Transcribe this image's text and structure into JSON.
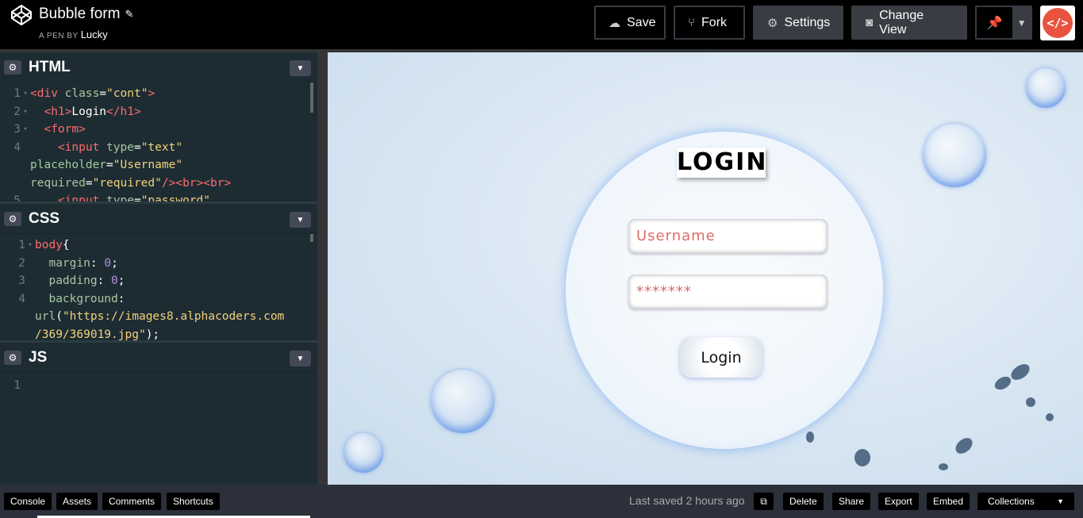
{
  "header": {
    "title": "Bubble form",
    "byline_prefix": "A PEN BY",
    "author": "Lucky",
    "buttons": {
      "save": "Save",
      "fork": "Fork",
      "settings": "Settings",
      "change_view": "Change View"
    }
  },
  "editors": {
    "html": {
      "label": "HTML",
      "lines": [
        {
          "n": "1",
          "parts": [
            [
              "tag",
              "<div "
            ],
            [
              "attr",
              "class"
            ],
            [
              "plain",
              "="
            ],
            [
              "str",
              "\"cont\""
            ],
            [
              "tag",
              ">"
            ]
          ]
        },
        {
          "n": "2",
          "parts": [
            [
              "plain",
              "  "
            ],
            [
              "tag",
              "<h1>"
            ],
            [
              "plain",
              "Login"
            ],
            [
              "tag",
              "</h1>"
            ]
          ]
        },
        {
          "n": "3",
          "parts": [
            [
              "plain",
              "  "
            ],
            [
              "tag",
              "<form>"
            ]
          ]
        },
        {
          "n": "4",
          "parts": [
            [
              "plain",
              "    "
            ],
            [
              "tag",
              "<input "
            ],
            [
              "attr",
              "type"
            ],
            [
              "plain",
              "="
            ],
            [
              "str",
              "\"text\""
            ]
          ]
        },
        {
          "n": "",
          "parts": [
            [
              "attr",
              "placeholder"
            ],
            [
              "plain",
              "="
            ],
            [
              "str",
              "\"Username\""
            ]
          ]
        },
        {
          "n": "",
          "parts": [
            [
              "attr",
              "required"
            ],
            [
              "plain",
              "="
            ],
            [
              "str",
              "\"required\""
            ],
            [
              "tag",
              "/><br><br>"
            ]
          ]
        },
        {
          "n": "5",
          "parts": [
            [
              "plain",
              "    "
            ],
            [
              "tag",
              "<input "
            ],
            [
              "attr",
              "type"
            ],
            [
              "plain",
              "="
            ],
            [
              "str",
              "\"password\""
            ]
          ]
        }
      ]
    },
    "css": {
      "label": "CSS",
      "lines": [
        {
          "n": "1",
          "parts": [
            [
              "sel",
              "body"
            ],
            [
              "plain",
              "{"
            ]
          ]
        },
        {
          "n": "2",
          "parts": [
            [
              "plain",
              "  "
            ],
            [
              "prop",
              "margin"
            ],
            [
              "plain",
              ": "
            ],
            [
              "num",
              "0"
            ],
            [
              "plain",
              ";"
            ]
          ]
        },
        {
          "n": "3",
          "parts": [
            [
              "plain",
              "  "
            ],
            [
              "prop",
              "padding"
            ],
            [
              "plain",
              ": "
            ],
            [
              "num",
              "0"
            ],
            [
              "plain",
              ";"
            ]
          ]
        },
        {
          "n": "4",
          "parts": [
            [
              "plain",
              "  "
            ],
            [
              "prop",
              "background"
            ],
            [
              "plain",
              ":"
            ]
          ]
        },
        {
          "n": "",
          "parts": [
            [
              "prop",
              "url"
            ],
            [
              "plain",
              "("
            ],
            [
              "str",
              "\"https://images8.alphacoders.com"
            ]
          ]
        },
        {
          "n": "",
          "parts": [
            [
              "str",
              "/369/369019.jpg\""
            ],
            [
              "plain",
              ");"
            ]
          ]
        }
      ]
    },
    "js": {
      "label": "JS",
      "lines": [
        {
          "n": "1",
          "parts": []
        }
      ]
    }
  },
  "preview": {
    "heading": "LOGIN",
    "username_placeholder": "Username",
    "password_value": "*******",
    "login_button": "Login"
  },
  "footer": {
    "console": "Console",
    "assets": "Assets",
    "comments": "Comments",
    "shortcuts": "Shortcuts",
    "saved": "Last saved 2 hours ago",
    "delete": "Delete",
    "share": "Share",
    "export": "Export",
    "embed": "Embed",
    "collections": "Collections"
  },
  "colors": {
    "tag": "#ff6b6b",
    "attr": "#a6c8a0",
    "string": "#f2d27a",
    "number": "#b190e0",
    "avatar": "#e8533f"
  }
}
